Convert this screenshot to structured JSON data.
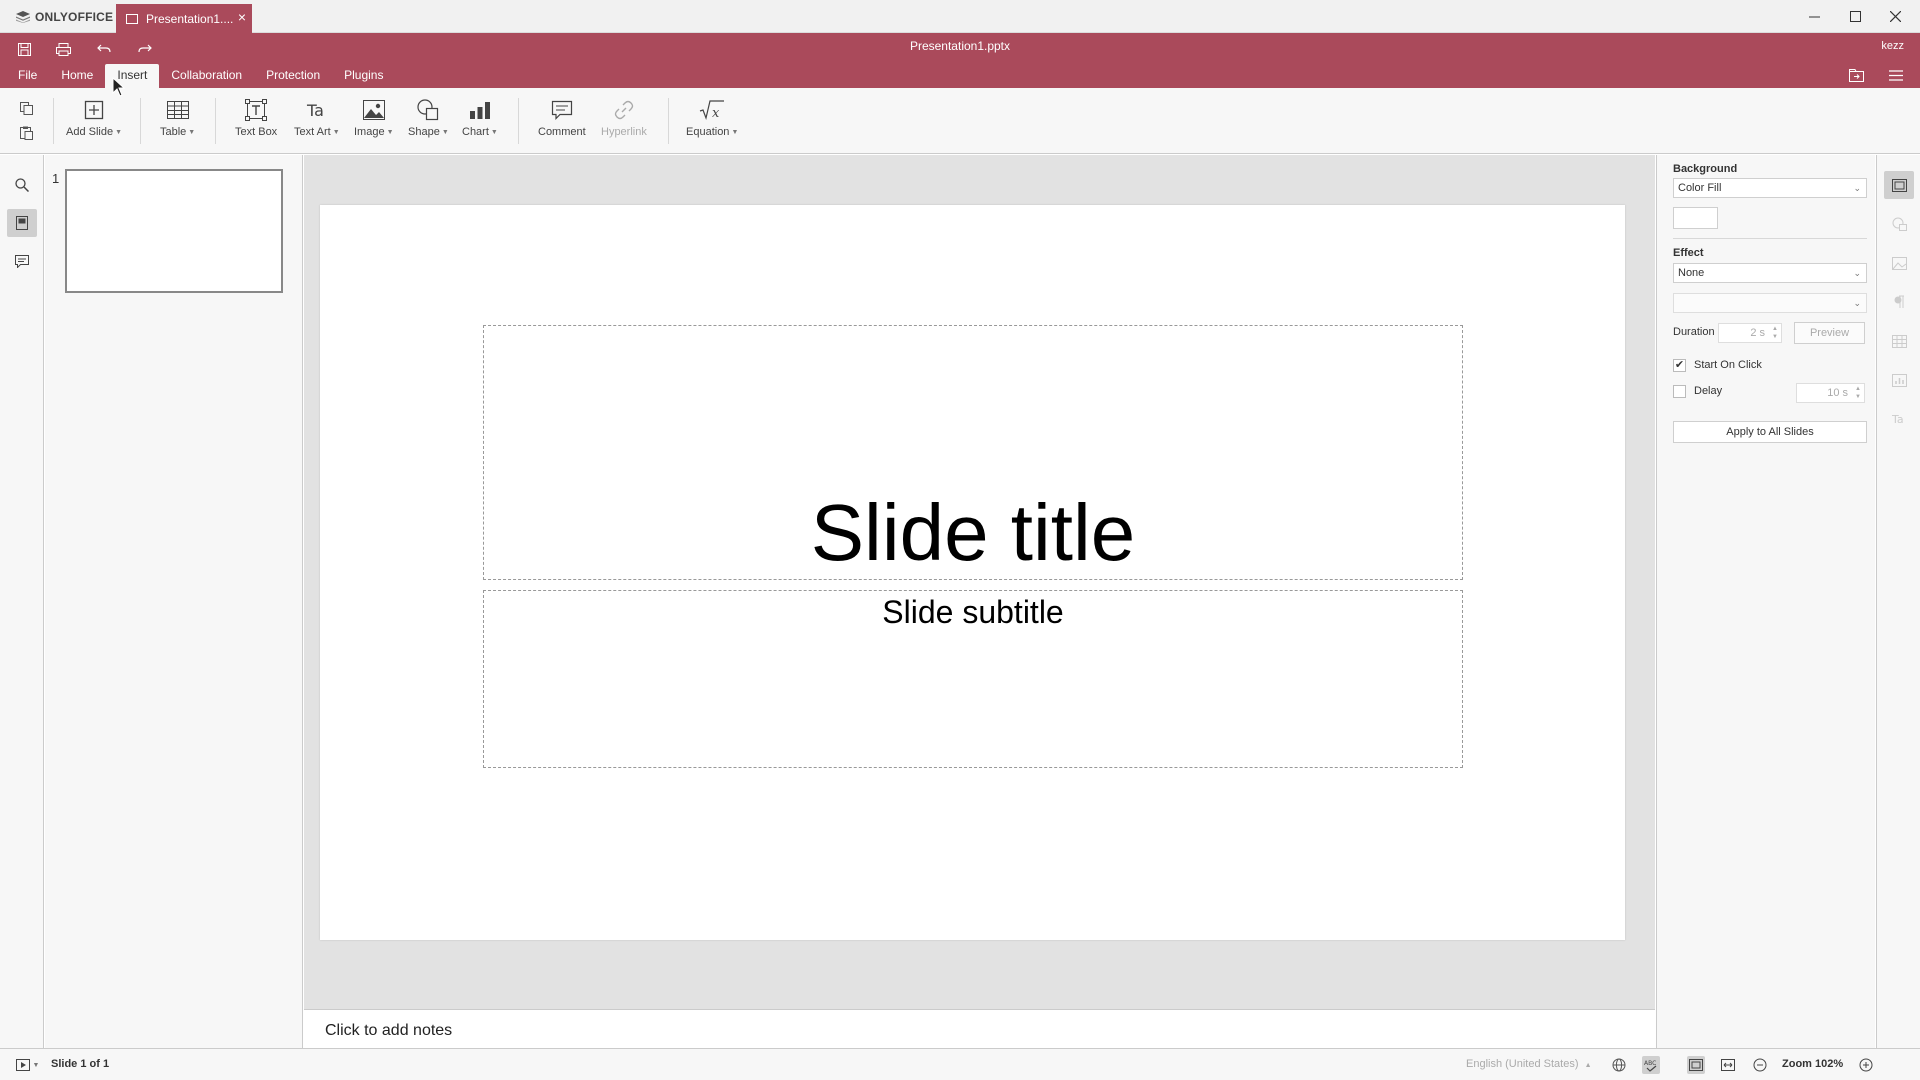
{
  "titlebar": {
    "app_name": "ONLYOFFICE",
    "tab_label": "Presentation1....",
    "window_controls": [
      "minimize-icon",
      "maximize-icon",
      "close-icon"
    ]
  },
  "header": {
    "document_title": "Presentation1.pptx",
    "user": "kezz",
    "quick_actions": [
      "save-icon",
      "print-icon",
      "undo-icon",
      "redo-icon"
    ],
    "menu": [
      {
        "label": "File"
      },
      {
        "label": "Home"
      },
      {
        "label": "Insert",
        "active": true
      },
      {
        "label": "Collaboration"
      },
      {
        "label": "Protection"
      },
      {
        "label": "Plugins"
      }
    ]
  },
  "toolbar": {
    "add_slide": "Add Slide",
    "table": "Table",
    "text_box": "Text Box",
    "text_art": "Text Art",
    "image": "Image",
    "shape": "Shape",
    "chart": "Chart",
    "comment": "Comment",
    "hyperlink": "Hyperlink",
    "equation": "Equation"
  },
  "thumbnails": {
    "slide_number": "1"
  },
  "slide": {
    "title": "Slide title",
    "subtitle": "Slide subtitle"
  },
  "notes": {
    "placeholder": "Click to add notes"
  },
  "right_panel": {
    "background_label": "Background",
    "background_fill": "Color Fill",
    "effect_label": "Effect",
    "effect_value": "None",
    "effect_type_value": "",
    "duration_label": "Duration",
    "duration_value": "2 s",
    "preview_label": "Preview",
    "start_on_click_label": "Start On Click",
    "start_on_click_checked": true,
    "delay_label": "Delay",
    "delay_checked": false,
    "delay_value": "10 s",
    "apply_all_label": "Apply to All Slides"
  },
  "statusbar": {
    "slide_info": "Slide 1 of 1",
    "language": "English (United States)",
    "zoom": "Zoom 102%"
  },
  "colors": {
    "accent": "#aa4a5b",
    "toolbar_bg": "#f7f7f7",
    "canvas_bg": "#e2e2e2"
  }
}
